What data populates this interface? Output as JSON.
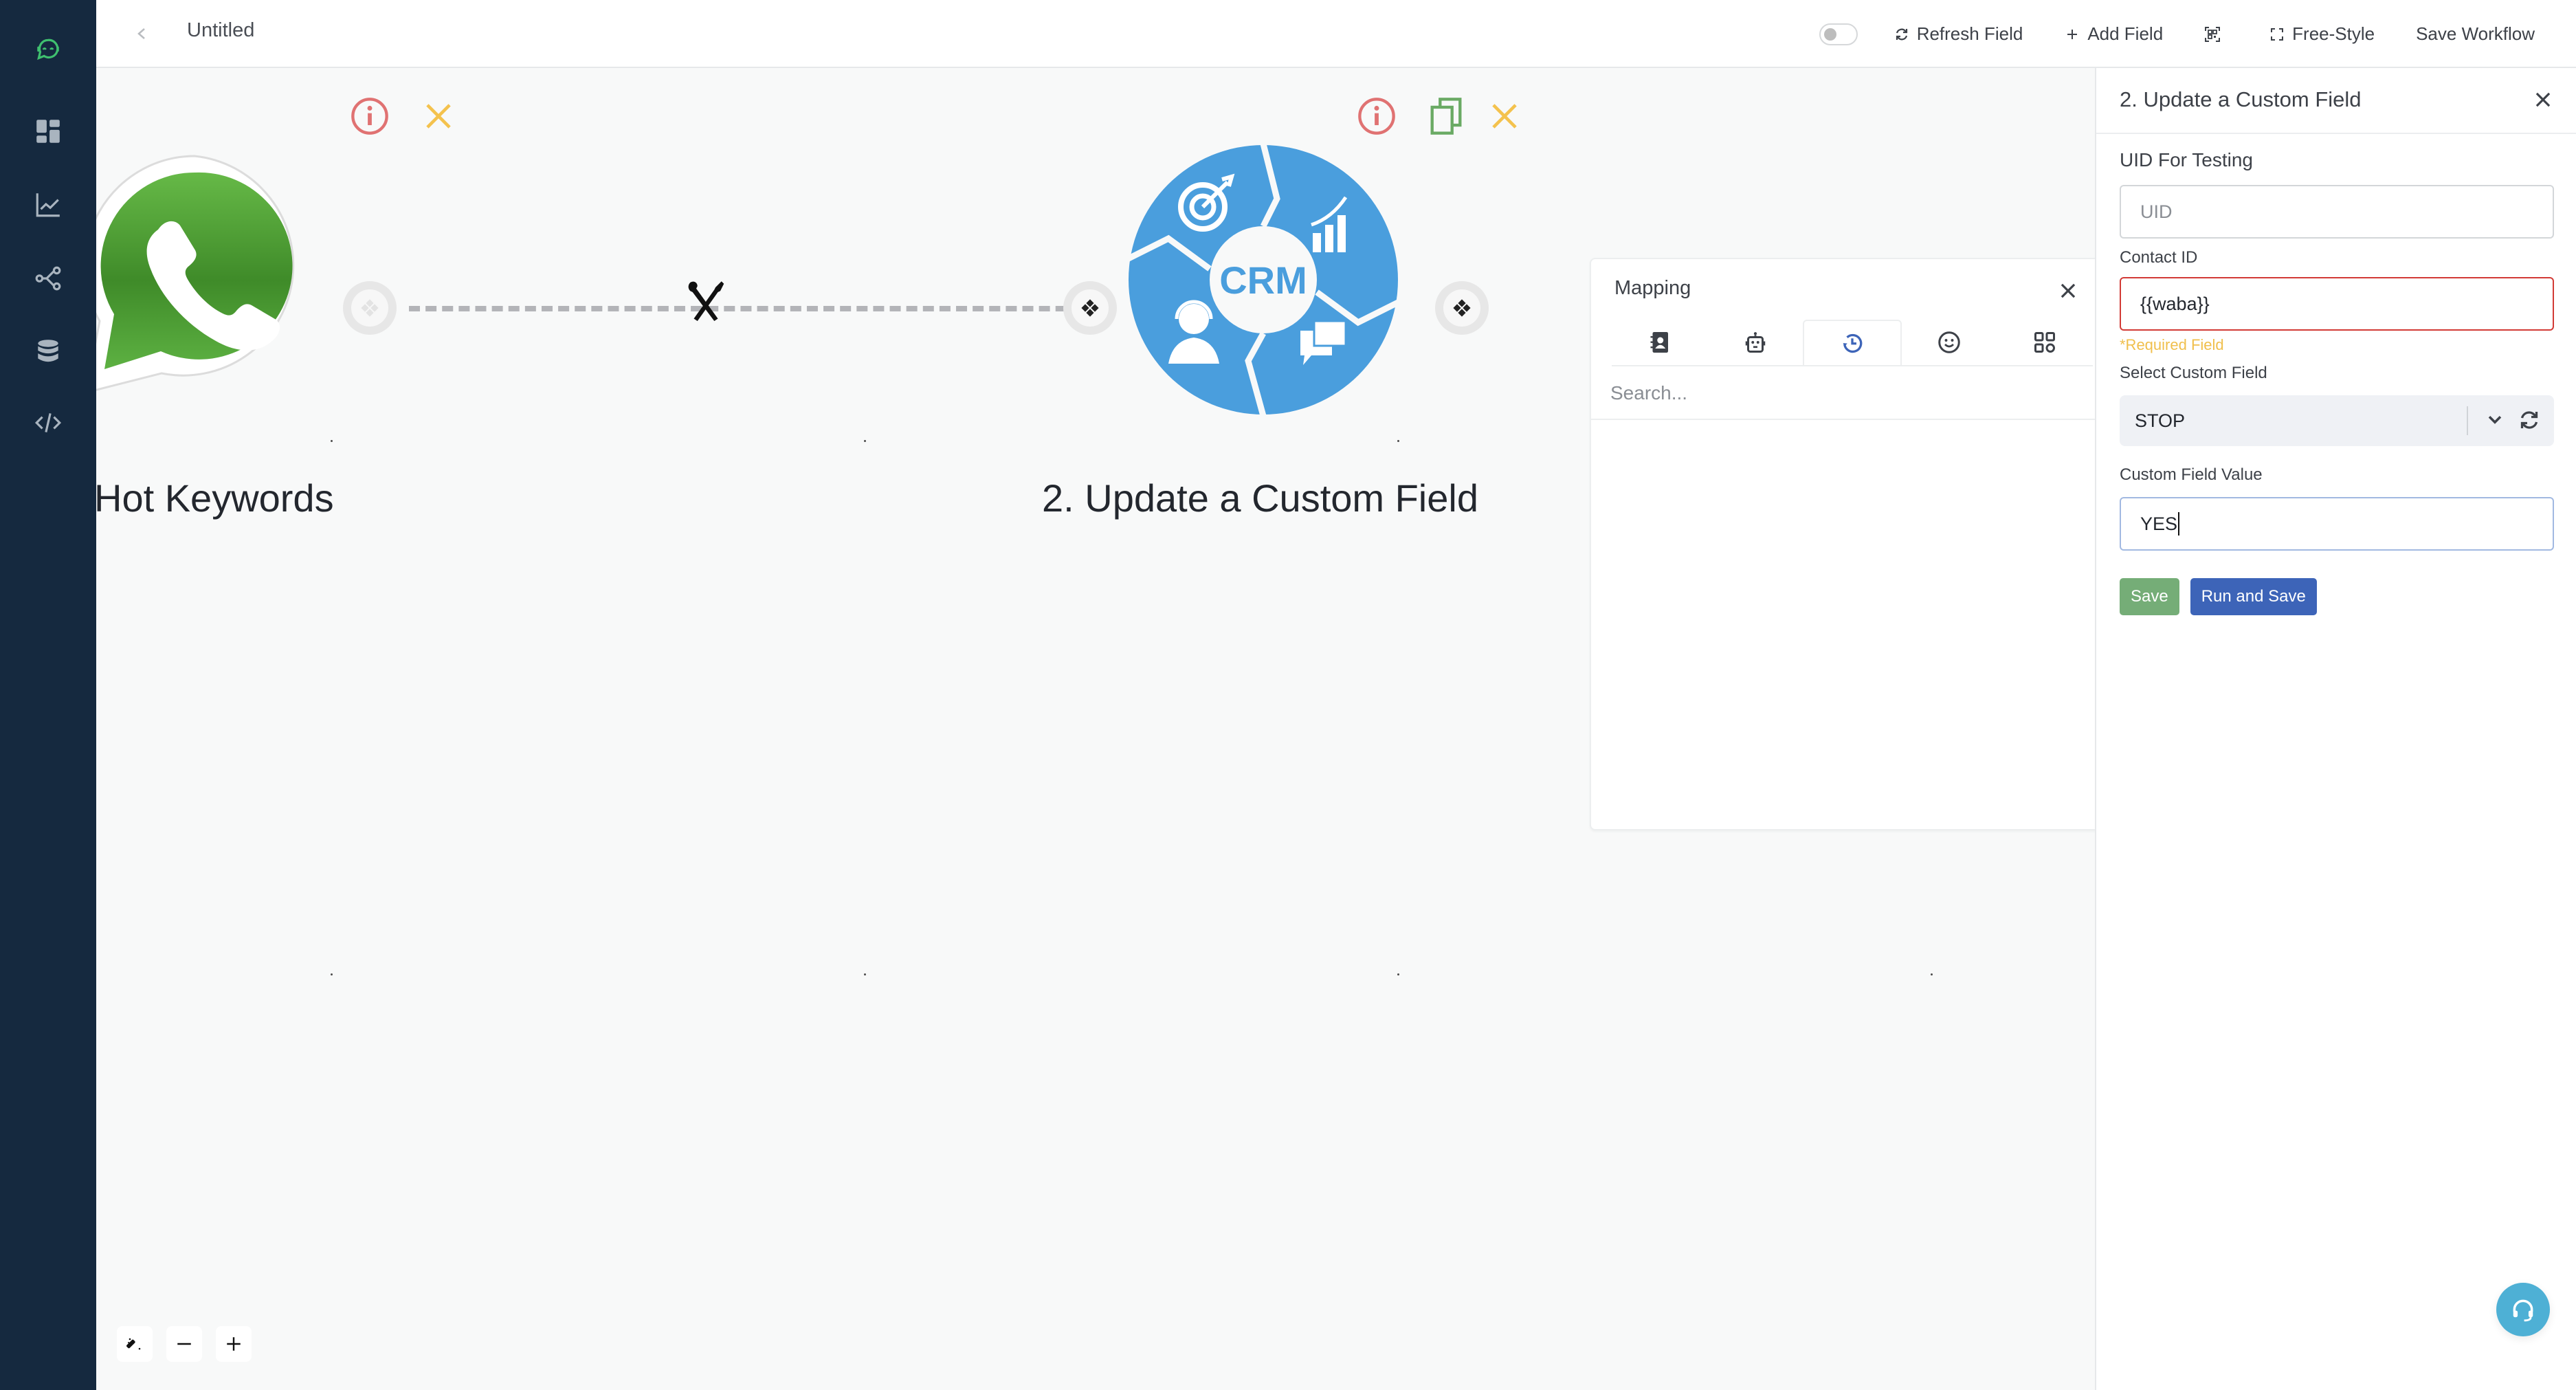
{
  "app": {
    "title": "Untitled",
    "brand_color": "#3fc06f",
    "sidebar_bg": "#15293f"
  },
  "sidebar": {
    "items": [
      {
        "icon": "bot-logo-icon",
        "label": "Home"
      },
      {
        "icon": "dashboard-icon",
        "label": "Dashboard"
      },
      {
        "icon": "analytics-icon",
        "label": "Analytics"
      },
      {
        "icon": "flow-icon",
        "label": "Workflows"
      },
      {
        "icon": "database-icon",
        "label": "Database"
      },
      {
        "icon": "code-icon",
        "label": "Developer"
      }
    ]
  },
  "toolbar": {
    "toggle_on": false,
    "refresh_label": "Refresh Field",
    "add_label": "Add Field",
    "freestyle_label": "Free-Style",
    "save_label": "Save Workflow"
  },
  "canvas": {
    "nodes": [
      {
        "label": "Hot Keywords",
        "icon": "whatsapp-icon"
      },
      {
        "label": "2. Update a Custom Field",
        "icon": "crm-icon",
        "crm_text": "CRM"
      }
    ],
    "connector_icon": "tools-icon"
  },
  "mapping": {
    "title": "Mapping",
    "tabs": [
      {
        "icon": "contacts-icon",
        "active": false
      },
      {
        "icon": "robot-icon",
        "active": false
      },
      {
        "icon": "history-icon",
        "active": true
      },
      {
        "icon": "emoji-icon",
        "active": false
      },
      {
        "icon": "apps-icon",
        "active": false
      }
    ],
    "search_placeholder": "Search..."
  },
  "panel": {
    "title": "2. Update a Custom Field",
    "uid_label": "UID For Testing",
    "uid_placeholder": "UID",
    "contact_label": "Contact ID",
    "contact_value": "{{waba}}",
    "required_text": "*Required Field",
    "select_label": "Select Custom Field",
    "select_value": "STOP",
    "value_label": "Custom Field Value",
    "value_value": "YES",
    "save_button": "Save",
    "run_save_button": "Run and Save"
  },
  "colors": {
    "info": "#e07272",
    "duplicate": "#6aaa64",
    "delete": "#f4c24d",
    "crm_blue": "#4a9edd",
    "error_border": "#d23b36",
    "required": "#f0bf4c",
    "save_btn": "#75ad77",
    "run_btn": "#3d64b8",
    "support": "#4eb0d5"
  }
}
